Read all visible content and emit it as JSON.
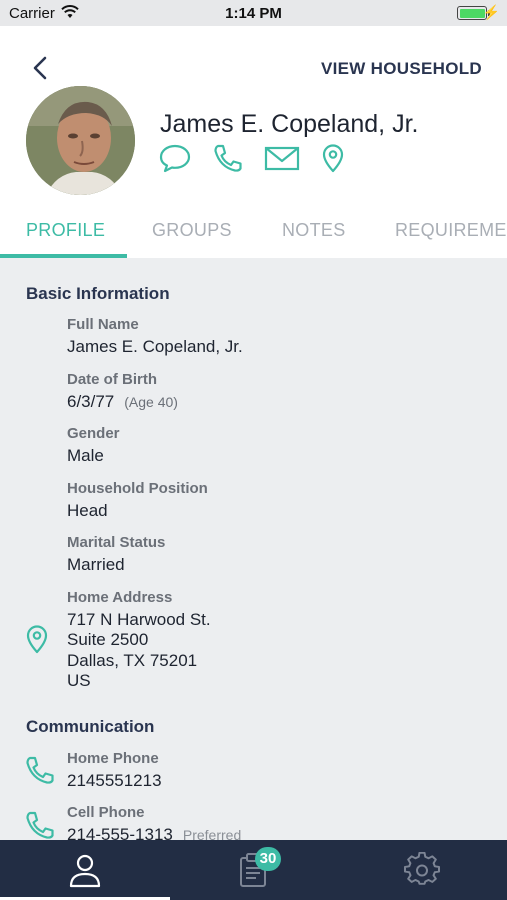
{
  "status_bar": {
    "carrier": "Carrier",
    "time": "1:14 PM",
    "battery_level": 1.0,
    "battery_color": "#4cd964"
  },
  "header": {
    "back_icon": "chevron-left-icon",
    "view_household_label": "VIEW HOUSEHOLD",
    "person_name": "James E. Copeland, Jr.",
    "action_icons": [
      "chat-bubble-icon",
      "phone-icon",
      "mail-icon",
      "location-pin-icon"
    ]
  },
  "tabs": [
    {
      "label": "PROFILE",
      "active": true
    },
    {
      "label": "GROUPS",
      "active": false
    },
    {
      "label": "NOTES",
      "active": false
    },
    {
      "label": "REQUIREMENTS",
      "active": false
    }
  ],
  "basic_info": {
    "title": "Basic Information",
    "fields": [
      {
        "label": "Full Name",
        "value": "James E. Copeland, Jr."
      },
      {
        "label": "Date of Birth",
        "value": "6/3/77",
        "note": "(Age 40)"
      },
      {
        "label": "Gender",
        "value": "Male"
      },
      {
        "label": "Household Position",
        "value": "Head"
      },
      {
        "label": "Marital Status",
        "value": "Married"
      }
    ],
    "address": {
      "label": "Home Address",
      "icon": "location-pin-icon",
      "lines": [
        "717 N Harwood St.",
        "Suite 2500",
        "Dallas, TX 75201",
        "US"
      ]
    }
  },
  "communication": {
    "title": "Communication",
    "phones": [
      {
        "label": "Home Phone",
        "value": "2145551213",
        "icon": "phone-icon"
      },
      {
        "label": "Cell Phone",
        "value": "214-555-1313",
        "note": "Preferred",
        "icon": "phone-icon"
      }
    ]
  },
  "tab_bar": {
    "items": [
      {
        "icon": "person-icon",
        "active": true
      },
      {
        "icon": "clipboard-icon",
        "badge": "30"
      },
      {
        "icon": "gear-icon"
      }
    ]
  },
  "colors": {
    "accent": "#3dbba5",
    "navy": "#2a3550",
    "tab_bar_bg": "#222d44"
  }
}
